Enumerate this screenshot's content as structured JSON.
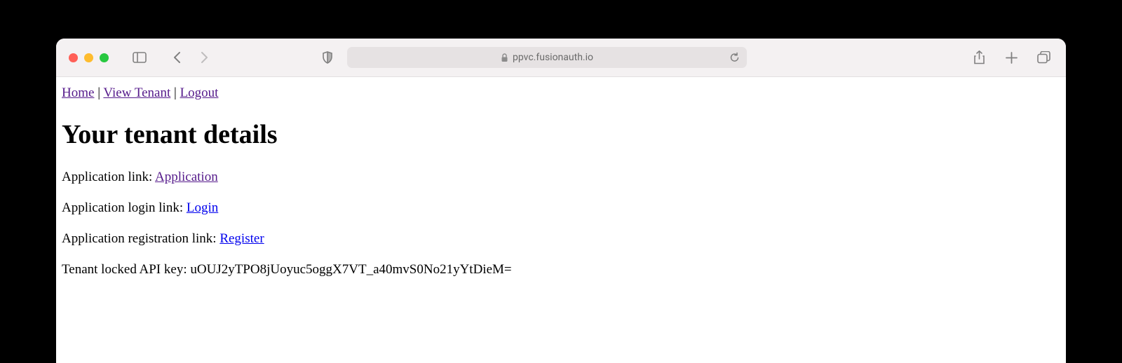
{
  "browser": {
    "url": "ppvc.fusionauth.io"
  },
  "nav": {
    "home": "Home",
    "view_tenant": "View Tenant",
    "logout": "Logout",
    "sep": " | "
  },
  "page": {
    "title": "Your tenant details"
  },
  "details": {
    "app_link_label": "Application link: ",
    "app_link_text": "Application",
    "login_link_label": "Application login link: ",
    "login_link_text": "Login",
    "register_link_label": "Application registration link: ",
    "register_link_text": "Register",
    "api_key_label": "Tenant locked API key: ",
    "api_key_value": "uOUJ2yTPO8jUoyuc5oggX7VT_a40mvS0No21yYtDieM="
  }
}
